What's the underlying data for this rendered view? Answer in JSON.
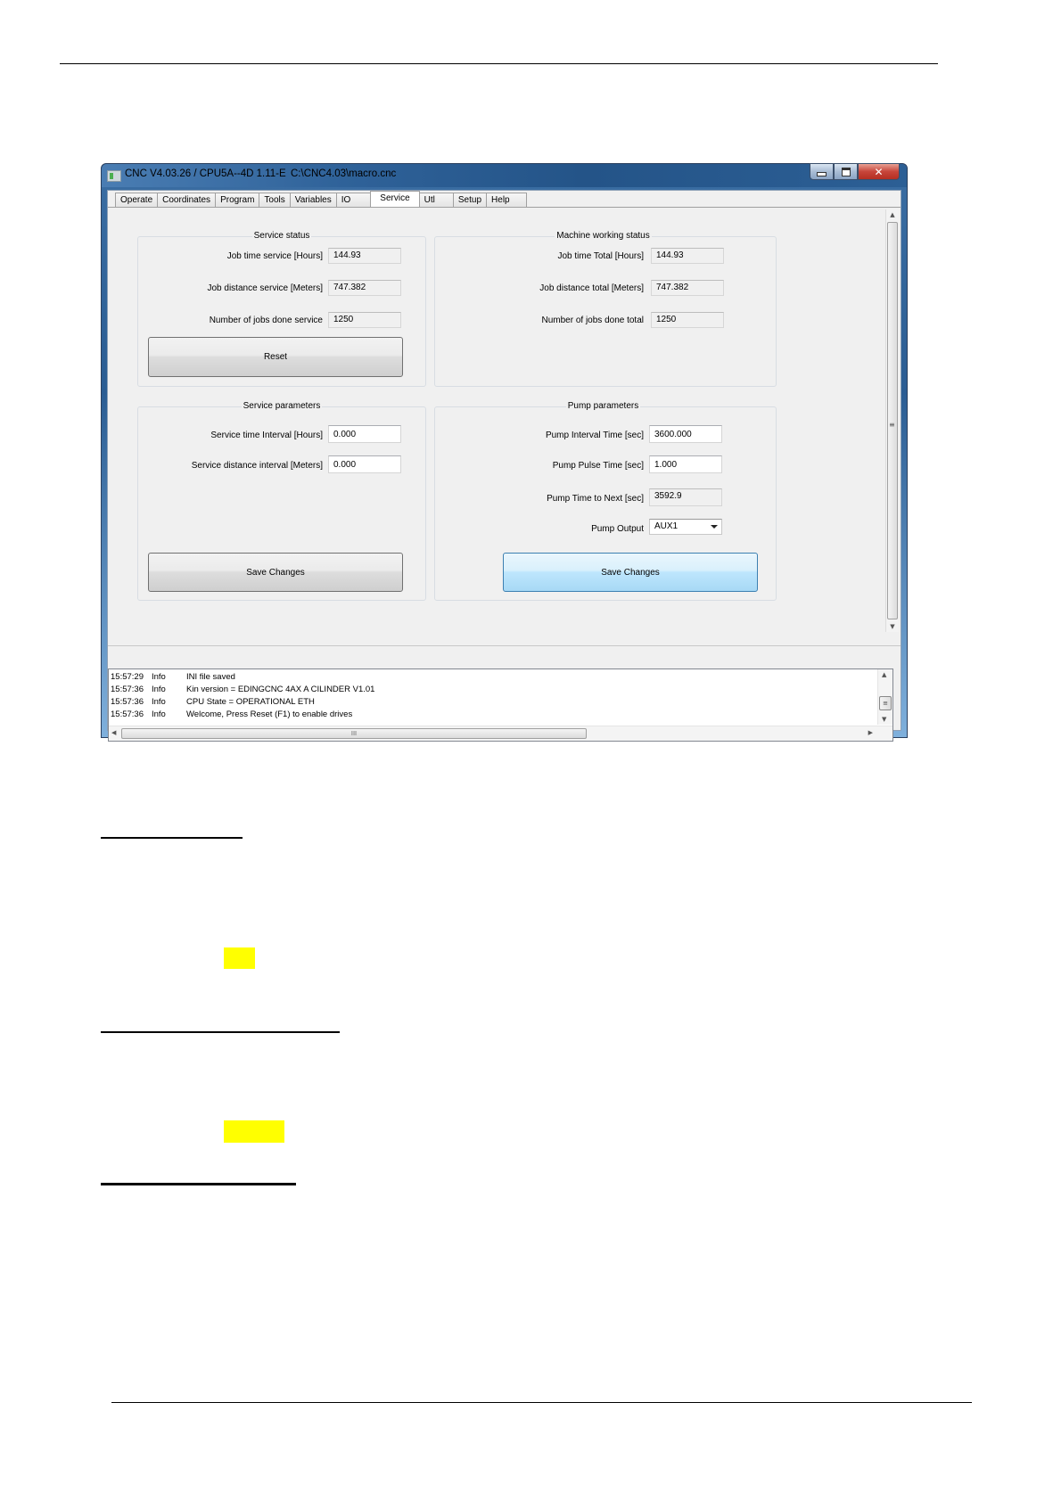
{
  "window": {
    "title": "CNC V4.03.26 / CPU5A--4D 1.11-E",
    "file_path": "C:\\CNC4.03\\macro.cnc",
    "controls": {
      "minimize": "minimize",
      "maximize": "maximize",
      "close": "✕"
    }
  },
  "tabs": [
    {
      "label": "Operate"
    },
    {
      "label": "Coordinates"
    },
    {
      "label": "Program"
    },
    {
      "label": "Tools"
    },
    {
      "label": "Variables"
    },
    {
      "label": "IO"
    },
    {
      "label": "Service",
      "active": true
    },
    {
      "label": "Utl"
    },
    {
      "label": "Setup"
    },
    {
      "label": "Help"
    }
  ],
  "service_status": {
    "title": "Service status",
    "rows": [
      {
        "label": "Job time service [Hours]",
        "value": "144.93"
      },
      {
        "label": "Job distance service [Meters]",
        "value": "747.382"
      },
      {
        "label": "Number of jobs done service",
        "value": "1250"
      }
    ],
    "reset_label": "Reset"
  },
  "machine_status": {
    "title": "Machine working status",
    "rows": [
      {
        "label": "Job time Total [Hours]",
        "value": "144.93"
      },
      {
        "label": "Job distance total [Meters]",
        "value": "747.382"
      },
      {
        "label": "Number of jobs done total",
        "value": "1250"
      }
    ]
  },
  "service_parameters": {
    "title": "Service parameters",
    "rows": [
      {
        "label": "Service time Interval [Hours]",
        "value": "0.000"
      },
      {
        "label": "Service distance interval [Meters]",
        "value": "0.000"
      }
    ],
    "save_label": "Save Changes"
  },
  "pump_parameters": {
    "title": "Pump parameters",
    "interval": {
      "label": "Pump Interval Time [sec]",
      "value": "3600.000"
    },
    "pulse": {
      "label": "Pump Pulse Time [sec]",
      "value": "1.000"
    },
    "time_to_next": {
      "label": "Pump Time to Next [sec]",
      "value": "3592.9"
    },
    "output": {
      "label": "Pump Output",
      "selected": "AUX1"
    },
    "save_label": "Save Changes"
  },
  "log": [
    {
      "time": "15:57:29",
      "level": "Info",
      "message": "INI file saved"
    },
    {
      "time": "15:57:36",
      "level": "Info",
      "message": "Kin version = EDINGCNC 4AX A CILINDER V1.01"
    },
    {
      "time": "15:57:36",
      "level": "Info",
      "message": "CPU State = OPERATIONAL ETH"
    },
    {
      "time": "15:57:36",
      "level": "Info",
      "message": "Welcome, Press Reset (F1) to enable drives"
    }
  ],
  "scroll_glyphs": {
    "up": "▲",
    "down": "▼",
    "left": "◀",
    "right": "▶",
    "grip_v": "≡",
    "grip_h": "III"
  },
  "colors": {
    "highlight": "#ffff00",
    "accent_button": "#bee6fd"
  }
}
